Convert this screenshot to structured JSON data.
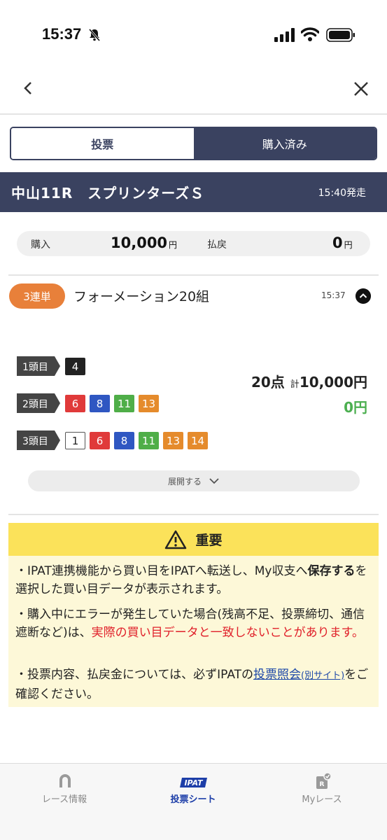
{
  "status_bar": {
    "time": "15:37"
  },
  "segment": {
    "left": "投票",
    "right": "購入済み"
  },
  "race": {
    "name": "中山11R　スプリンターズＳ",
    "deadline": "15:40発走"
  },
  "totals": {
    "purchase_label": "購入",
    "purchase_value": "10,000",
    "purchase_unit": "円",
    "payout_label": "払戻",
    "payout_value": "0",
    "payout_unit": "円"
  },
  "bet": {
    "badge": "3連単",
    "type": "フォーメーション20組",
    "time": "15:37",
    "rows": [
      {
        "label": "1頭目",
        "horses": [
          {
            "num": "4",
            "color": "#222222"
          }
        ]
      },
      {
        "label": "2頭目",
        "horses": [
          {
            "num": "6",
            "color": "#e03a3a"
          },
          {
            "num": "8",
            "color": "#2f57c2"
          },
          {
            "num": "11",
            "color": "#4fae48"
          },
          {
            "num": "13",
            "color": "#e58b2c"
          }
        ]
      },
      {
        "label": "3頭目",
        "horses": [
          {
            "num": "1",
            "color": "#ffffff"
          },
          {
            "num": "6",
            "color": "#e03a3a"
          },
          {
            "num": "8",
            "color": "#2f57c2"
          },
          {
            "num": "11",
            "color": "#4fae48"
          },
          {
            "num": "13",
            "color": "#e58b2c"
          },
          {
            "num": "14",
            "color": "#e58b2c"
          }
        ]
      }
    ],
    "points": "20点",
    "kei": "計",
    "amount": "10,000円",
    "payout": "0円",
    "expand_label": "展開する"
  },
  "notice": {
    "title": "重要",
    "p1_a": "・IPAT連携機能から買い目をIPATへ転送し、My収支へ",
    "p1_b": "保存する",
    "p1_c": "を選択した買い目データが表示されます。",
    "p2_a": "・購入中にエラーが発生していた場合(残高不足、投票締切、通信遮断など)は、",
    "p2_b": "実際の買い目データと一致しないことがあります。",
    "p3_a": "・投票内容、払戻金については、必ずIPATの",
    "p3_link": "投票照会",
    "p3_link_small": "(別サイト)",
    "p3_b": "をご確認ください。"
  },
  "tabs": [
    {
      "label": "レース情報",
      "icon": "horseshoe-icon"
    },
    {
      "label": "投票シート",
      "icon": "ipat-icon",
      "icon_text": "IPAT"
    },
    {
      "label": "Myレース",
      "icon": "my-race-icon"
    }
  ],
  "colors": {
    "navy": "#3a4260",
    "orange": "#e8803a",
    "green": "#4caf50",
    "red": "#e0202a",
    "link": "#1d48a8"
  }
}
